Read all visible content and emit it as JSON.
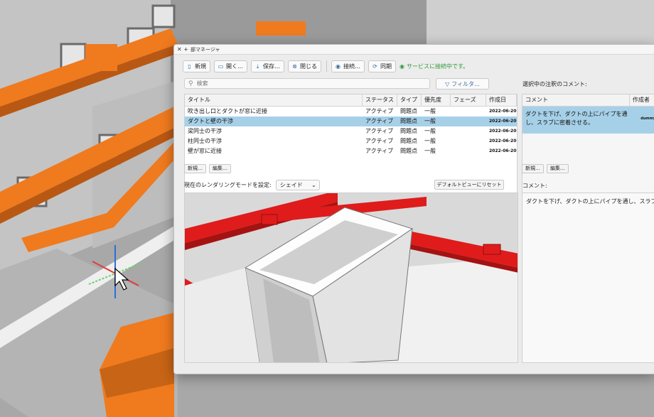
{
  "window": {
    "title": "部マネージャ",
    "title_icon": "close-plus-icon"
  },
  "toolbar": {
    "new_label": "新規",
    "open_label": "開く…",
    "save_label": "保存…",
    "close_label": "閉じる",
    "connect_label": "接続…",
    "sync_label": "同期",
    "status_text": "サービスに接続中です。"
  },
  "search": {
    "placeholder": "検索"
  },
  "filter": {
    "label": "フィルタ…"
  },
  "issues": {
    "columns": [
      "タイトル",
      "ステータス",
      "タイプ",
      "優先度",
      "フェーズ",
      "作成日"
    ],
    "rows": [
      {
        "title": "吹き出し口とダクトが窓に近接",
        "status": "アクティブ",
        "type": "問題点",
        "priority": "一般",
        "phase": "",
        "date": "2022-06-20"
      },
      {
        "title": "ダクトと壁の干渉",
        "status": "アクティブ",
        "type": "問題点",
        "priority": "一般",
        "phase": "",
        "date": "2022-06-20"
      },
      {
        "title": "梁同士の干渉",
        "status": "アクティブ",
        "type": "問題点",
        "priority": "一般",
        "phase": "",
        "date": "2022-06-20"
      },
      {
        "title": "柱同士の干渉",
        "status": "アクティブ",
        "type": "問題点",
        "priority": "一般",
        "phase": "",
        "date": "2022-06-20"
      },
      {
        "title": "壁が窓に近接",
        "status": "アクティブ",
        "type": "問題点",
        "priority": "一般",
        "phase": "",
        "date": "2022-06-20"
      }
    ],
    "new_btn": "新規…",
    "edit_btn": "編集…"
  },
  "comments": {
    "heading": "選択中の注釈のコメント:",
    "columns": [
      "コメント",
      "作成者"
    ],
    "row_text": "ダクトを下げ、ダクトの上にパイプを通し、スラブに密着させる。",
    "row_author": "dummyUser",
    "new_btn": "新規…",
    "edit_btn": "編集…",
    "detail_label": "コメント:",
    "detail_text": "ダクトを下げ、ダクトの上にパイプを通し、スラブに"
  },
  "render": {
    "label": "現在のレンダリングモードを設定:",
    "mode": "シェイド",
    "reset_label": "デフォルトビューにリセット"
  },
  "colors": {
    "duct_orange": "#f07a1e",
    "duct_red": "#e01b1b",
    "selection": "#a6d0e8",
    "status_green": "#2e9a3a"
  }
}
